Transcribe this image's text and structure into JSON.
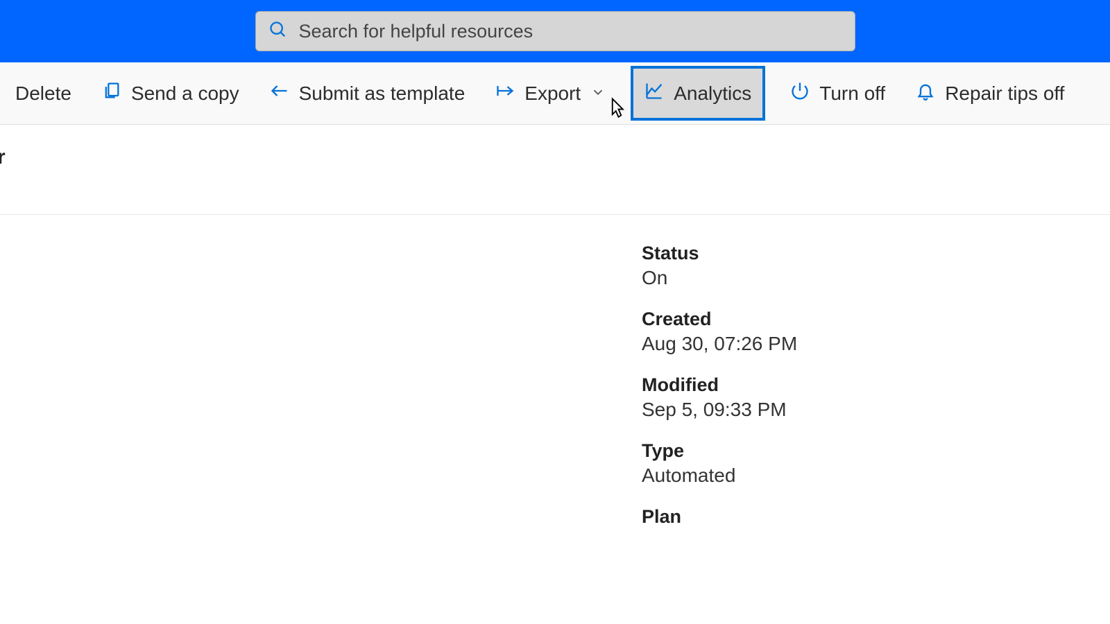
{
  "header": {
    "search_placeholder": "Search for helpful resources"
  },
  "toolbar": {
    "delete_label": "Delete",
    "send_copy_label": "Send a copy",
    "submit_template_label": "Submit as template",
    "export_label": "Export",
    "analytics_label": "Analytics",
    "turn_off_label": "Turn off",
    "repair_tips_label": "Repair tips off"
  },
  "title_fragment": "r",
  "details": {
    "status_label": "Status",
    "status_value": "On",
    "created_label": "Created",
    "created_value": "Aug 30, 07:26 PM",
    "modified_label": "Modified",
    "modified_value": "Sep 5, 09:33 PM",
    "type_label": "Type",
    "type_value": "Automated",
    "plan_label": "Plan"
  }
}
